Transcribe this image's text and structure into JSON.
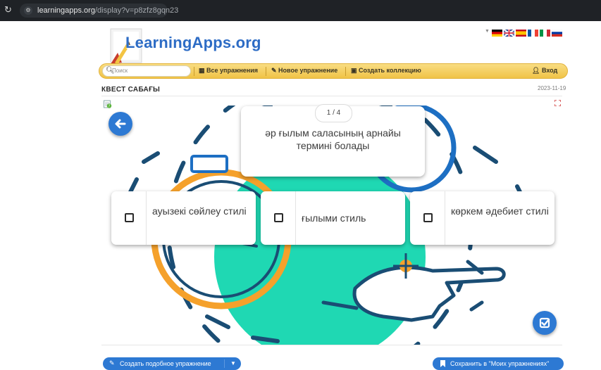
{
  "browser": {
    "url_host": "learningapps.org",
    "url_path": "/display?v=p8zfz8gqn23"
  },
  "header": {
    "logo_text": "LearningApps.org",
    "search_placeholder": "Поиск",
    "nav": {
      "all_exercises": "Все упражнения",
      "new_exercise": "Новое упражнение",
      "create_collection": "Создать коллекцию",
      "login": "Вход"
    },
    "languages": [
      "de",
      "en",
      "es",
      "fr",
      "it",
      "ru"
    ]
  },
  "exercise": {
    "title": "КВЕСТ САБАҒЫ",
    "date": "2023-11-19",
    "counter": "1 / 4",
    "question": "әр ғылым саласының арнайы термині болады",
    "options": [
      "ауызекі сөйлеу стилі",
      "ғылыми стиль",
      "көркем әдебиет стилі"
    ]
  },
  "footer": {
    "create_similar": "Создать подобное упражнение",
    "save_to_mine": "Сохранить в \"Моих упражнениях\""
  },
  "colors": {
    "accent_blue": "#2d79d3",
    "nav_yellow": "#f0c346",
    "art_teal": "#1fd8b3",
    "art_blue": "#1d6fc3",
    "art_orange": "#f5a12b"
  },
  "icons": {
    "back": "arrow-left-icon",
    "check": "check-square-icon",
    "help": "help-icon",
    "expand": "fullscreen-icon"
  }
}
